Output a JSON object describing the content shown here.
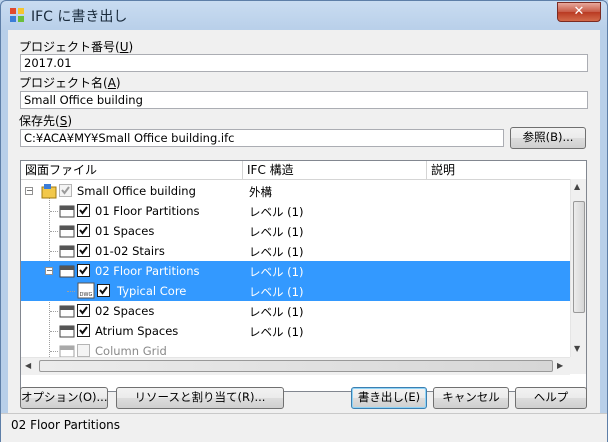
{
  "window": {
    "title": "IFC に書き出し",
    "close_glyph": "✕"
  },
  "project_number": {
    "label_pre": "プロジェクト番号(",
    "label_key": "U",
    "label_post": ")",
    "value": "2017.01"
  },
  "project_name": {
    "label_pre": "プロジェクト名(",
    "label_key": "A",
    "label_post": ")",
    "value": "Small Office building"
  },
  "save_to": {
    "label_pre": "保存先(",
    "label_key": "S",
    "label_post": ")",
    "value": "C:¥ACA¥MY¥Small Office building.ifc",
    "browse_label": "参照(B)..."
  },
  "grid": {
    "columns": [
      "図面ファイル",
      "IFC 構造",
      "説明"
    ],
    "rows": [
      {
        "name": "Small Office building",
        "structure": "外構"
      },
      {
        "name": "01 Floor Partitions",
        "structure": "レベル (1)"
      },
      {
        "name": "01 Spaces",
        "structure": "レベル (1)"
      },
      {
        "name": "01-02 Stairs",
        "structure": "レベル (1)"
      },
      {
        "name": "02 Floor Partitions",
        "structure": "レベル (1)"
      },
      {
        "name": "Typical Core",
        "structure": "レベル (1)"
      },
      {
        "name": "02 Spaces",
        "structure": "レベル (1)"
      },
      {
        "name": "Atrium Spaces",
        "structure": "レベル (1)"
      },
      {
        "name": "Column Grid",
        "structure": ""
      }
    ],
    "expander_minus": "−",
    "dwg_badge": "DWG"
  },
  "buttons": {
    "options": "オプション(O)...",
    "resources": "リソースと割り当て(R)...",
    "export": "書き出し(E)",
    "cancel": "キャンセル",
    "help": "ヘルプ"
  },
  "status": {
    "text": "02 Floor Partitions"
  },
  "colors": {
    "selection": "#3399ff",
    "title_bar": "#c9dcf1",
    "close": "#c75a45"
  },
  "icons": [
    "app-icon",
    "close-icon",
    "project-icon",
    "drawing-file-icon",
    "checkbox-checked-icon",
    "expand-minus-icon",
    "scroll-up-icon",
    "scroll-down-icon",
    "scroll-left-icon",
    "scroll-right-icon"
  ]
}
